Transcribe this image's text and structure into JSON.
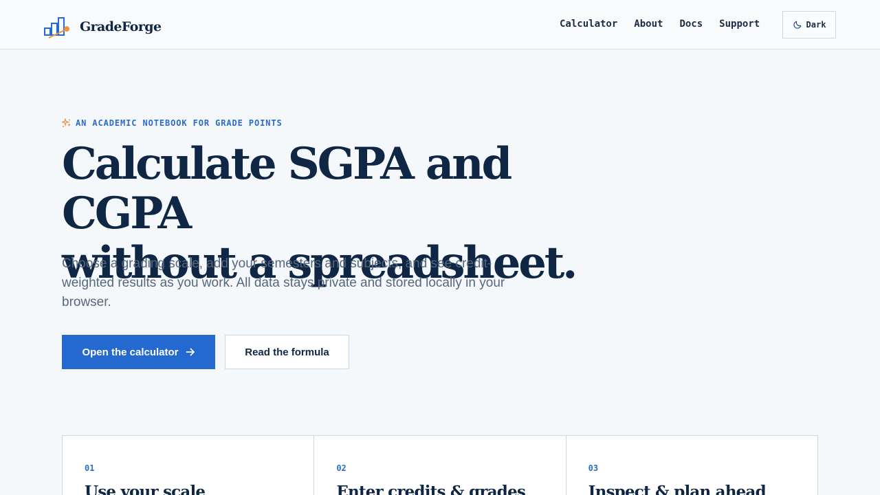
{
  "brand": {
    "name": "GradeForge",
    "logo_icon": "bar-chart-icon"
  },
  "nav": {
    "items": [
      "Calculator",
      "About",
      "Docs",
      "Support"
    ],
    "theme_toggle_label": "Dark",
    "theme_toggle_icon": "moon-icon"
  },
  "hero": {
    "eyebrow": "AN ACADEMIC NOTEBOOK FOR GRADE POINTS",
    "eyebrow_icon": "sparkle-icon",
    "title_line1": "Calculate SGPA and CGPA",
    "title_line2": "without a spreadsheet.",
    "subtitle": "Choose a grading scale, add your semesters and subjects, and see credit-weighted results as you work. All data stays private and stored locally in your browser.",
    "primary_cta": "Open the calculator",
    "secondary_cta": "Read the formula"
  },
  "steps": [
    {
      "num": "01",
      "title": "Use your scale"
    },
    {
      "num": "02",
      "title": "Enter credits & grades"
    },
    {
      "num": "03",
      "title": "Inspect & plan ahead"
    }
  ],
  "colors": {
    "accent": "#2469cf",
    "heading": "#0f2744",
    "orange": "#e8954a",
    "background": "#f5f8fb"
  }
}
